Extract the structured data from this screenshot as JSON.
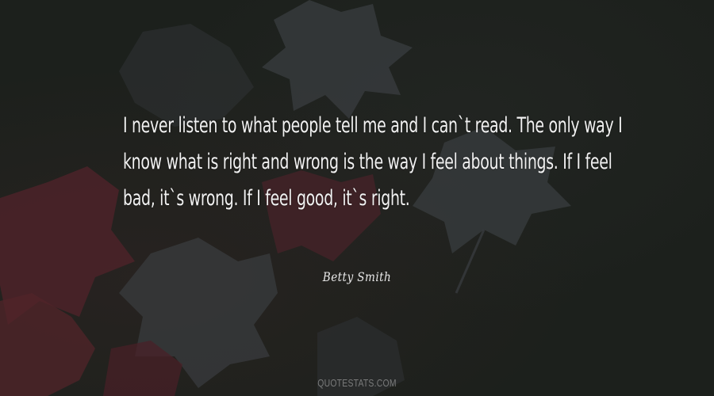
{
  "quote": {
    "text": "I never listen to what people tell me and I can`t read. The only way I know what is right and wrong is the way I feel about things. If I feel bad, it`s wrong. If I feel good, it`s right."
  },
  "author": {
    "name": "Betty Smith"
  },
  "watermark": {
    "text": "QUOTESTATS.COM"
  },
  "colors": {
    "background": "#1c201c",
    "leaf_gray": "#3a3d3f",
    "leaf_red": "#5a2a30",
    "text": "#f1f1f1"
  }
}
